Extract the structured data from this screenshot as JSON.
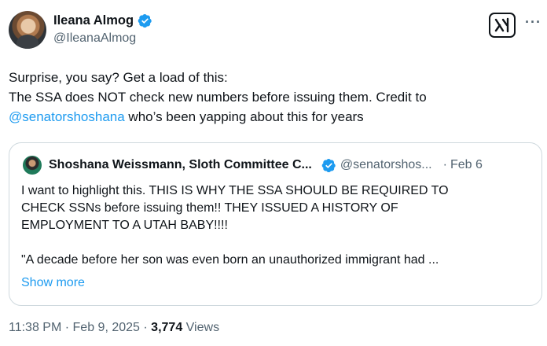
{
  "author": {
    "display_name": "Ileana Almog",
    "handle": "@IleanaAlmog"
  },
  "tweet": {
    "line1": "Surprise, you say? Get a load of this:",
    "line2": "The SSA does NOT check new numbers before issuing them. Credit to",
    "line3_mention": "@senatorshoshana",
    "line3_rest": " who’s been yapping about this for years"
  },
  "quoted_tweet": {
    "display_name": "Shoshana Weissmann, Sloth Committee C...",
    "handle": "@senatorshos...",
    "separator": "·",
    "date": "Feb 6",
    "body_lines": [
      "I want to highlight this. THIS IS WHY THE SSA SHOULD BE REQUIRED TO",
      "CHECK SSNs before issuing them!! THEY ISSUED A HISTORY OF",
      "EMPLOYMENT TO A UTAH BABY!!!!"
    ],
    "body_line_after_gap": "\"A decade before her son was even born an unauthorized immigrant had ...",
    "show_more": "Show more"
  },
  "meta": {
    "time": "11:38 PM",
    "dot1": "·",
    "date": "Feb 9, 2025",
    "dot2": "·",
    "views_count": "3,774",
    "views_label": "Views"
  },
  "icons": {
    "verified": "verified-badge-icon",
    "grok": "grok-icon",
    "more": "more-icon"
  },
  "colors": {
    "link": "#1d9bf0",
    "secondary": "#536471",
    "border": "#cfd9de"
  }
}
